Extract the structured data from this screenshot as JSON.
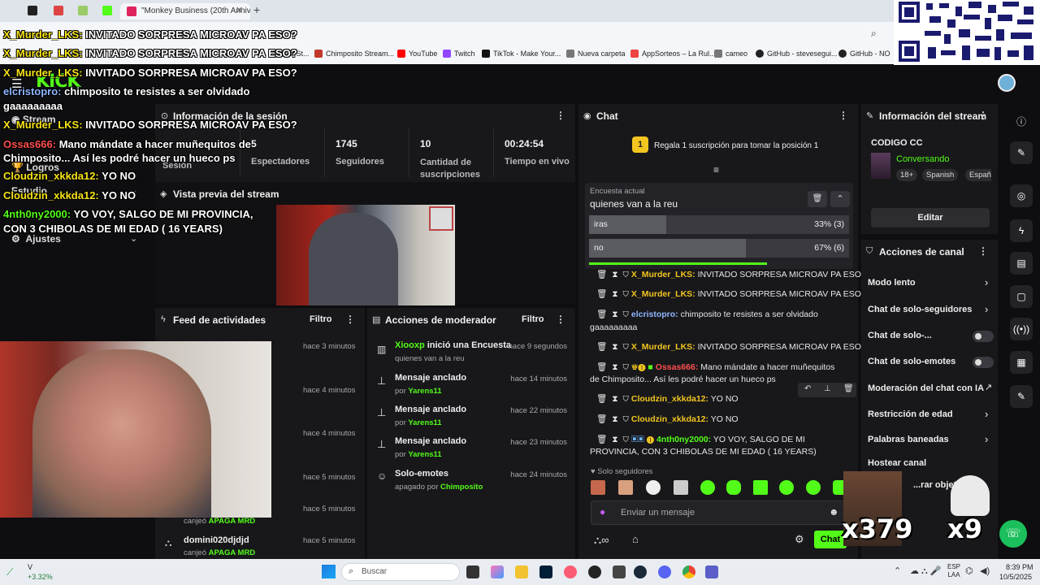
{
  "browser": {
    "active_tab_title": "\"Monkey Business (20th Anniv",
    "bookmarks": [
      "Kick St...",
      "Chimposito Stream...",
      "YouTube",
      "Twitch",
      "TikTok - Make Your...",
      "Nueva carpeta",
      "AppSorteos – La Rul...",
      "cameo",
      "GitHub - stevesegui...",
      "GitHub - NO"
    ]
  },
  "overlay_chat": [
    {
      "user": "X_Murder_LKS:",
      "text": "INVITADO SORPRESA MICROAV PA ESO?"
    },
    {
      "user": "X_Murder_LKS:",
      "text": "INVITADO SORPRESA MICROAV PA ESO?"
    },
    {
      "user": "X_Murder_LKS:",
      "text": "INVITADO SORPRESA MICROAV PA ESO?"
    },
    {
      "user": "elcristopro:",
      "text": "chimposito te resistes a ser olvidado"
    },
    {
      "user": "",
      "text": "gaaaaaaaaa"
    },
    {
      "user": "X_Murder_LKS:",
      "text": "INVITADO SORPRESA MICROAV PA ESO?"
    },
    {
      "user": "Ossas666:",
      "text": "Mano mándate a hacer muñequitos de"
    },
    {
      "user": "",
      "text": "Chimposito... Así les podré hacer un hueco ps"
    },
    {
      "user": "Cloudzin_xkkda12:",
      "text": "YO NO"
    },
    {
      "user": "Cloudzin_xkkda12:",
      "text": "YO NO"
    },
    {
      "user": "4nth0ny2000:",
      "text": "YO VOY, SALGO DE MI PROVINCIA,"
    },
    {
      "user": "",
      "text": "CON 3 CHIBOLAS DE MI EDAD ( 16 YEARS)"
    }
  ],
  "left_nav": {
    "stream": "Stream",
    "logros": "Logros",
    "estudio": "Estudio",
    "ajustes": "Ajustes"
  },
  "session": {
    "title": "Información de la sesión",
    "stats": [
      {
        "value": "",
        "label": "Sesión"
      },
      {
        "value": "5",
        "label": "Espectadores"
      },
      {
        "value": "1745",
        "label": "Seguidores"
      },
      {
        "value": "10",
        "label": "Cantidad de suscripciones"
      },
      {
        "value": "00:24:54",
        "label": "Tiempo en vivo"
      }
    ]
  },
  "preview": {
    "title": "Vista previa del stream"
  },
  "feed": {
    "title": "Feed de actividades",
    "filter": "Filtro",
    "times": [
      "hace 3 minutos",
      "hace 4 minutos",
      "hace 4 minutos",
      "hace 5 minutos",
      "hace 5 minutos",
      "hace 5 minutos"
    ],
    "last_user": "domini020djdjd",
    "canjeo_text": "canjeó",
    "canjeo_item": "APAGA MRD",
    "canjeo_item2": "APAGA MRD"
  },
  "mod_actions": {
    "title": "Acciones de moderador",
    "filter": "Filtro",
    "rows": [
      {
        "title_user": "Xiooxp",
        "title_rest": " inició una Encuesta",
        "sub": "quienes van a la reu",
        "time": "hace 9 segundos"
      },
      {
        "title": "Mensaje anclado",
        "sub_prefix": "por ",
        "sub_user": "Yarens11",
        "time": "hace 14 minutos"
      },
      {
        "title": "Mensaje anclado",
        "sub_prefix": "por ",
        "sub_user": "Yarens11",
        "time": "hace 22 minutos"
      },
      {
        "title": "Mensaje anclado",
        "sub_prefix": "por ",
        "sub_user": "Yarens11",
        "time": "hace 23 minutos"
      },
      {
        "title": "Solo-emotes",
        "sub_prefix": "apagado por ",
        "sub_user": "Chimposito",
        "time": "hace 24 minutos"
      }
    ]
  },
  "chat": {
    "title": "Chat",
    "gift_banner": "Regala 1 suscripción para tomar la posición 1",
    "gift_rank": "1",
    "poll": {
      "label": "Encuesta actual",
      "question": "quienes van a la reu",
      "options": [
        {
          "name": "iras",
          "percent": 33,
          "display": "33% (3)"
        },
        {
          "name": "no",
          "percent": 67,
          "display": "67% (6)"
        }
      ]
    },
    "messages": [
      {
        "user": "X_Murder_LKS:",
        "text": " INVITADO SORPRESA MICROAV PA ESO?",
        "color": "y"
      },
      {
        "user": "X_Murder_LKS:",
        "text": " INVITADO SORPRESA MICROAV PA ESO?",
        "color": "y"
      },
      {
        "user": "elcristopro:",
        "text": " chimposito te resistes a ser olvidado",
        "cont": "gaaaaaaaaa",
        "color": "b"
      },
      {
        "user": "X_Murder_LKS:",
        "text": " INVITADO SORPRESA MICROAV PA ESO?",
        "color": "y"
      },
      {
        "user": "Ossas666:",
        "text": " Mano mándate a hacer muñequitos",
        "cont": "de Chimposito... Así les podré hacer un hueco ps",
        "color": "r"
      },
      {
        "user": "Cloudzin_xkkda12:",
        "text": " YO NO",
        "color": "y"
      },
      {
        "user": "Cloudzin_xkkda12:",
        "text": " YO NO",
        "color": "y"
      },
      {
        "user": "4nth0ny2000:",
        "text": " YO VOY, SALGO DE MI",
        "cont": "PROVINCIA, CON 3 CHIBOLAS DE MI EDAD ( 16 YEARS)",
        "color": "g"
      }
    ],
    "followers_only": "Solo seguidores",
    "input_placeholder": "Enviar un mensaje",
    "send_label": "Chat"
  },
  "stream_info": {
    "title": "Información del stream",
    "stream_title": "CODIGO CC",
    "category": "Conversando",
    "tags": [
      "18+",
      "Spanish",
      "Españ"
    ],
    "edit_label": "Editar"
  },
  "channel_actions": {
    "title": "Acciones de canal",
    "rows": [
      {
        "label": "Modo lento",
        "control": "chevron"
      },
      {
        "label": "Chat de solo-seguidores",
        "control": "chevron"
      },
      {
        "label": "Chat de solo-...",
        "control": "toggle"
      },
      {
        "label": "Chat de solo-emotes",
        "control": "toggle"
      },
      {
        "label": "Moderación del chat con IA",
        "control": "link"
      },
      {
        "label": "Restricción de edad",
        "control": "chevron"
      },
      {
        "label": "Palabras baneadas",
        "control": "chevron"
      },
      {
        "label": "Hostear canal",
        "control": "none"
      },
      {
        "label": "...rar objetivos",
        "control": "chevron"
      }
    ]
  },
  "overlays": {
    "combo1": "x379",
    "combo2": "x9"
  },
  "taskbar": {
    "stock_label": "V",
    "stock_change": "+3.32%",
    "search_placeholder": "Buscar",
    "lang1": "ESP",
    "lang2": "LAA",
    "time": "8:39 PM",
    "date": "10/5/2025"
  },
  "colors": {
    "kick_green": "#53fc18",
    "panel": "#18181b",
    "bg": "#0e0e10"
  }
}
